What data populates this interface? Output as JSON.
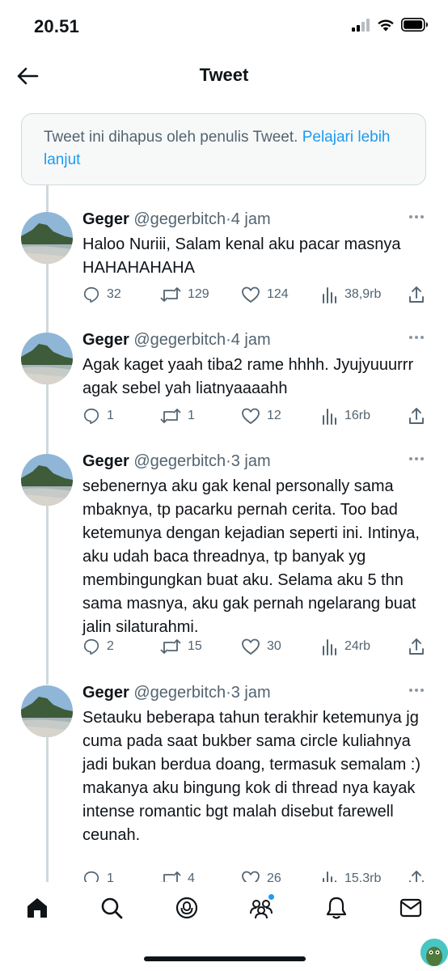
{
  "status_bar": {
    "time": "20.51",
    "icons": [
      "cellular-signal-icon",
      "wifi-icon",
      "battery-icon"
    ]
  },
  "header": {
    "title": "Tweet",
    "back_icon": "arrow-left-icon"
  },
  "deleted_notice": {
    "text": "Tweet ini dihapus oleh penulis Tweet.",
    "link": "Pelajari lebih lanjut"
  },
  "tweets": [
    {
      "name": "Geger",
      "handle": "@gegerbitch",
      "time": "4 jam",
      "text": "Haloo Nuriii, Salam kenal aku pacar masnya HAHAHAHAHA",
      "replies": "32",
      "retweets": "129",
      "likes": "124",
      "views": "38,9rb"
    },
    {
      "name": "Geger",
      "handle": "@gegerbitch",
      "time": "4 jam",
      "text": "Agak kaget yaah tiba2 rame hhhh. Jyujyuuurrr agak sebel yah liatnyaaaahh",
      "replies": "1",
      "retweets": "1",
      "likes": "12",
      "views": "16rb"
    },
    {
      "name": "Geger",
      "handle": "@gegerbitch",
      "time": "3 jam",
      "text": "sebenernya aku gak kenal personally sama mbaknya, tp pacarku pernah cerita. Too bad ketemunya dengan kejadian seperti ini. Intinya, aku udah baca threadnya, tp banyak yg membingungkan buat aku. Selama aku 5 thn sama masnya, aku gak pernah ngelarang buat jalin silaturahmi.",
      "replies": "2",
      "retweets": "15",
      "likes": "30",
      "views": "24rb"
    },
    {
      "name": "Geger",
      "handle": "@gegerbitch",
      "time": "3 jam",
      "text": "Setauku beberapa tahun terakhir ketemunya jg cuma pada saat bukber sama circle kuliahnya jadi bukan berdua doang, termasuk semalam :) makanya aku bingung kok di thread nya kayak intense romantic bgt malah disebut farewell ceunah.",
      "replies": "1",
      "retweets": "4",
      "likes": "26",
      "views": "15,3rb"
    }
  ],
  "bottom_nav": {
    "items": [
      "home-icon",
      "search-icon",
      "spaces-icon",
      "communities-icon",
      "notifications-icon",
      "messages-icon"
    ]
  },
  "colors": {
    "accent": "#1d9bf0",
    "text_primary": "#0f1419",
    "text_secondary": "#536471",
    "border": "#cfd9de"
  }
}
